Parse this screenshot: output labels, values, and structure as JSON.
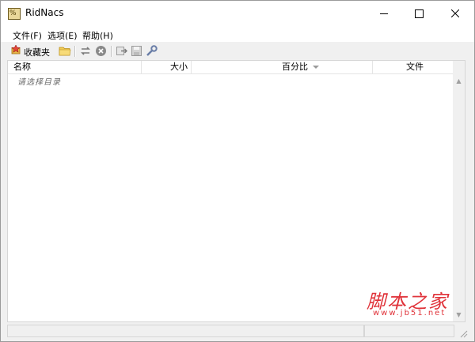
{
  "window": {
    "title": "RidNacs",
    "icon": "ridnacs-app-icon"
  },
  "title_buttons": {
    "minimize": "minimize-icon",
    "maximize": "maximize-icon",
    "close": "close-icon"
  },
  "menu": [
    "文件(F)",
    "选项(E)",
    "帮助(H)"
  ],
  "toolbar": {
    "favorites_label": "收藏夹",
    "icons": [
      "favorites-star-icon",
      "open-folder-icon",
      "refresh-icon",
      "stop-icon",
      "export-icon",
      "save-icon",
      "settings-wrench-icon"
    ]
  },
  "list": {
    "columns": [
      "名称",
      "大小",
      "百分比",
      "文件"
    ],
    "sorted_column": "百分比",
    "placeholder": "请选择目录"
  },
  "watermark": {
    "main": "脚本之家",
    "sub": "www.jb51.net"
  },
  "colors": {
    "watermark": "#e0333a",
    "window_bg": "#f0f0f0"
  }
}
